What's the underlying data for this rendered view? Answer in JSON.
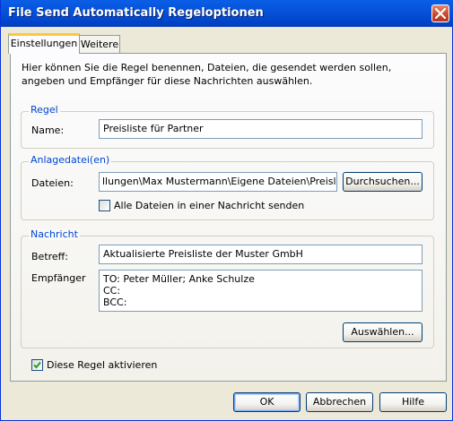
{
  "window": {
    "title": "File Send Automatically Regeloptionen"
  },
  "tabs": [
    {
      "label": "Einstellungen",
      "active": true
    },
    {
      "label": "Weitere",
      "active": false
    }
  ],
  "description": "Hier können Sie die Regel benennen, Dateien, die gesendet werden sollen, angeben und Empfänger für diese Nachrichten auswählen.",
  "regel": {
    "group_label": "Regel",
    "name_label": "Name:",
    "name_value": "Preisliste für Partner"
  },
  "anlage": {
    "group_label": "Anlagedatei(en)",
    "dateien_label": "Dateien:",
    "dateien_value": "llungen\\Max Mustermann\\Eigene Dateien\\Preisliste.xls",
    "browse_label": "Durchsuchen...",
    "all_files_label": "Alle Dateien in einer Nachricht senden",
    "all_files_checked": false
  },
  "nachricht": {
    "group_label": "Nachricht",
    "betreff_label": "Betreff:",
    "betreff_value": "Aktualisierte Preisliste der Muster GmbH",
    "empfaenger_label": "Empfänger",
    "to_line": "TO: Peter Müller; Anke Schulze",
    "cc_line": "CC:",
    "bcc_line": "BCC:",
    "select_label": "Auswählen..."
  },
  "activate": {
    "label": "Diese Regel aktivieren",
    "checked": true
  },
  "footer": {
    "ok_label": "OK",
    "cancel_label": "Abbrechen",
    "help_label": "Hilfe"
  }
}
